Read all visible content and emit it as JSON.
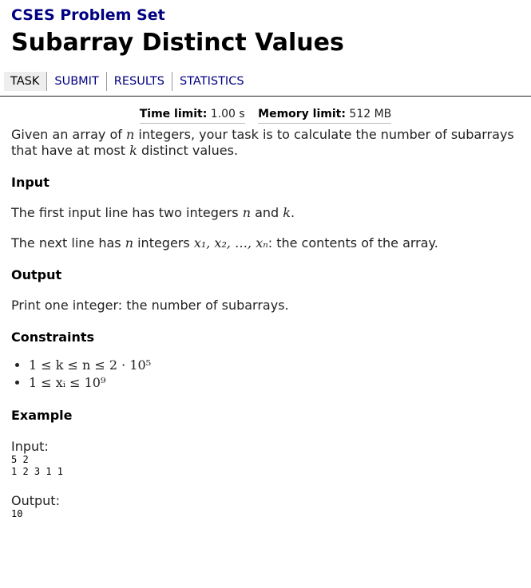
{
  "site": {
    "title": "CSES Problem Set"
  },
  "problem": {
    "title": "Subarray Distinct Values",
    "time_label": "Time limit:",
    "time_value": "1.00 s",
    "memory_label": "Memory limit:",
    "memory_value": "512 MB",
    "statement_a": "Given an array of ",
    "statement_n": "n",
    "statement_b": " integers, your task is to calculate the number of subarrays that have at most ",
    "statement_k": "k",
    "statement_c": " distinct values."
  },
  "nav": {
    "items": [
      {
        "label": "TASK",
        "current": true
      },
      {
        "label": "SUBMIT",
        "current": false
      },
      {
        "label": "RESULTS",
        "current": false
      },
      {
        "label": "STATISTICS",
        "current": false
      }
    ]
  },
  "input_section": {
    "heading": "Input",
    "line1_a": "The first input line has two integers ",
    "line1_n": "n",
    "line1_and": " and ",
    "line1_k": "k",
    "line1_end": ".",
    "line2_a": "The next line has ",
    "line2_n": "n",
    "line2_b": " integers ",
    "line2_seq": "x₁, x₂, …, xₙ",
    "line2_c": ": the contents of the array."
  },
  "output_section": {
    "heading": "Output",
    "text": "Print one integer: the number of subarrays."
  },
  "constraints": {
    "heading": "Constraints",
    "items": [
      "1 ≤ k ≤ n ≤ 2 · 10⁵",
      "1 ≤ xᵢ ≤ 10⁹"
    ]
  },
  "example": {
    "heading": "Example",
    "input_label": "Input:",
    "input_text": "5 2\n1 2 3 1 1",
    "output_label": "Output:",
    "output_text": "10"
  }
}
